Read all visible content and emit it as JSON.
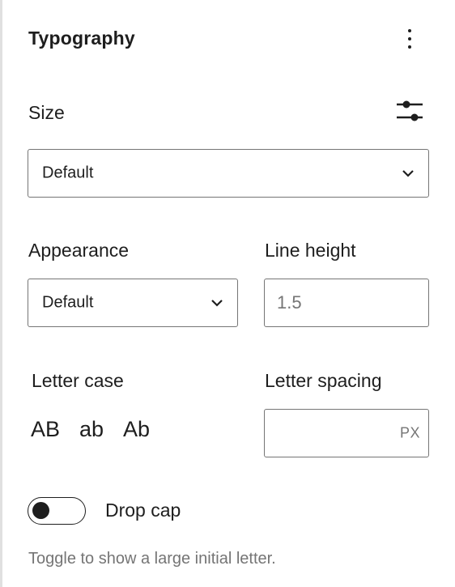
{
  "panel": {
    "title": "Typography",
    "menu_icon": "kebab-menu-icon"
  },
  "size": {
    "label": "Size",
    "settings_icon": "sliders-icon",
    "selected": "Default"
  },
  "appearance": {
    "label": "Appearance",
    "selected": "Default"
  },
  "line_height": {
    "label": "Line height",
    "placeholder": "1.5"
  },
  "letter_case": {
    "label": "Letter case",
    "options": [
      "AB",
      "ab",
      "Ab"
    ]
  },
  "letter_spacing": {
    "label": "Letter spacing",
    "value": "",
    "unit": "PX"
  },
  "drop_cap": {
    "label": "Drop cap",
    "enabled": false,
    "help": "Toggle to show a large initial letter."
  },
  "colors": {
    "text": "#1e1e1e",
    "muted": "#757575",
    "border": "#757575",
    "divider": "#e0e0e0"
  }
}
